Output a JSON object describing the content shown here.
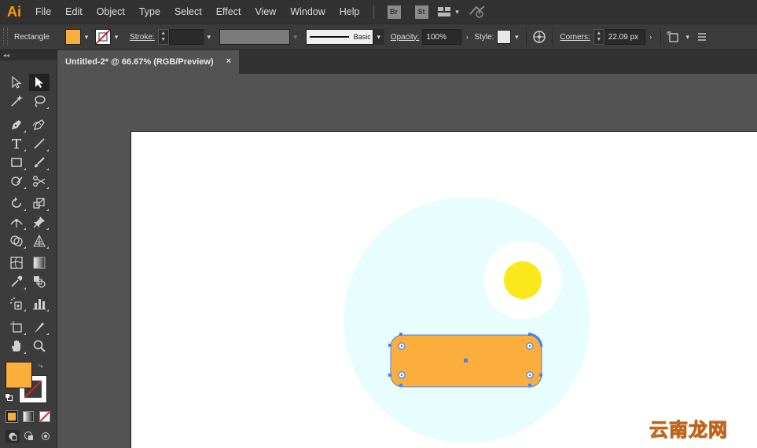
{
  "app": {
    "logo_text": "Ai",
    "logo_color": "#ff9a00"
  },
  "menu": {
    "items": [
      "File",
      "Edit",
      "Object",
      "Type",
      "Select",
      "Effect",
      "View",
      "Window",
      "Help"
    ],
    "bridge_badge": "Br",
    "stock_badge": "St"
  },
  "controlbar": {
    "tool_name": "Rectangle",
    "fill_color": "#fbae3c",
    "stroke_label": "Stroke:",
    "stroke_weight": "",
    "brush_label": "Basic",
    "opacity_label": "Opacity:",
    "opacity_value": "100%",
    "style_label": "Style:",
    "corners_label": "Corners:",
    "corners_value": "22.09 px"
  },
  "document": {
    "tab_title": "Untitled-2* @ 66.67% (RGB/Preview)",
    "close_glyph": "×"
  },
  "tools": {
    "fill_color": "#fbae3c",
    "collapse_glyph": "◂◂"
  },
  "artwork": {
    "background_circle_color": "#e8fdfe",
    "sun_halo_color": "#ffffff",
    "sun_color": "#fbe81c",
    "rectangle_fill": "#fbae3c",
    "selection_color": "#4a7ff0"
  },
  "watermark": {
    "text": "云南龙网"
  }
}
